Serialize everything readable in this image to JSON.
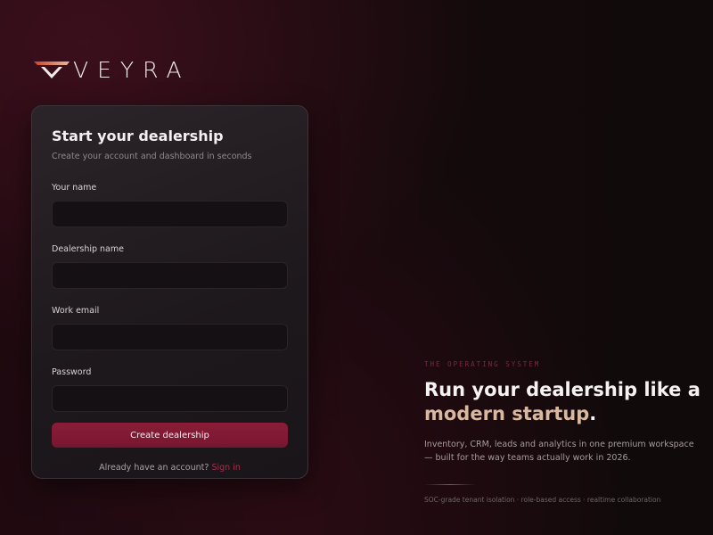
{
  "brand": {
    "logo_text": "VEYRA",
    "logo_gradient": [
      "#c9452b",
      "#e7b89a"
    ]
  },
  "form": {
    "title": "Start your dealership",
    "subtitle": "Create your account and dashboard in seconds",
    "fields": [
      {
        "label": "Your name",
        "value": "",
        "placeholder": ""
      },
      {
        "label": "Dealership name",
        "value": "",
        "placeholder": ""
      },
      {
        "label": "Work email",
        "value": "",
        "placeholder": ""
      },
      {
        "label": "Password",
        "value": "",
        "placeholder": ""
      }
    ],
    "submit_label": "Create dealership",
    "signin_prompt": "Already have an account?",
    "signin_link": "Sign in"
  },
  "hero": {
    "eyebrow": "THE OPERATING SYSTEM",
    "headline_prefix": "Run your dealership like a ",
    "headline_accent": "modern startup",
    "headline_suffix": ".",
    "description": "Inventory, CRM, leads and analytics in one premium workspace — built for the way teams actually work in 2026.",
    "features": "SOC-grade tenant isolation · role-based access · realtime collaboration"
  },
  "colors": {
    "accent": "#8a1d38",
    "link": "#a3314f",
    "headline_accent": "#d9b8a0"
  }
}
